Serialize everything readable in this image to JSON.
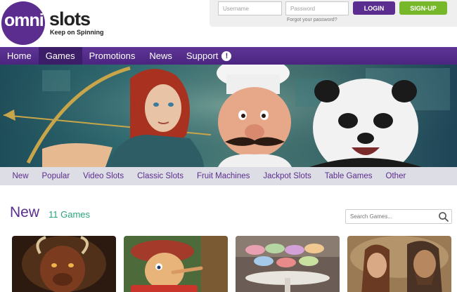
{
  "header": {
    "logo_omni": "omni",
    "logo_slots": "slots",
    "tagline": "Keep on Spinning"
  },
  "login": {
    "username_placeholder": "Username",
    "password_placeholder": "Password",
    "login_label": "LOGIN",
    "signup_label": "SIGN-UP",
    "forgot_label": "Forgot your password?"
  },
  "main_nav": {
    "items": [
      {
        "label": "Home",
        "active": false
      },
      {
        "label": "Games",
        "active": true
      },
      {
        "label": "Promotions",
        "active": false
      },
      {
        "label": "News",
        "active": false
      },
      {
        "label": "Support",
        "active": false,
        "badge": "!"
      }
    ]
  },
  "sub_nav": {
    "items": [
      "New",
      "Popular",
      "Video Slots",
      "Classic Slots",
      "Fruit Machines",
      "Jackpot Slots",
      "Table Games",
      "Other"
    ]
  },
  "section": {
    "title": "New",
    "count": "11 Games",
    "search_placeholder": "Search Games..."
  },
  "game_tiles": [
    {
      "icon": "minotaur-game-art"
    },
    {
      "icon": "pinocchio-game-art"
    },
    {
      "icon": "macarons-game-art"
    },
    {
      "icon": "warriors-game-art"
    }
  ],
  "colors": {
    "brand_purple": "#5b2d8e",
    "signup_green": "#76b82a",
    "count_green": "#2aa37a",
    "subnav_bg": "#dddde5"
  }
}
